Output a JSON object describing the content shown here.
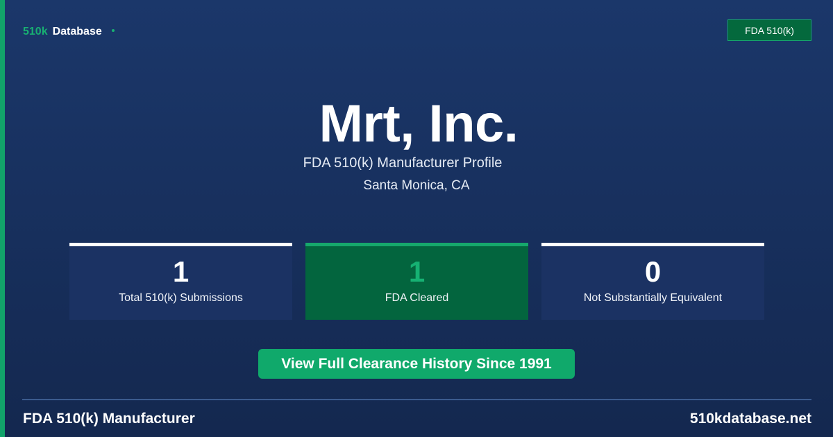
{
  "header": {
    "brand_accent": "510k",
    "brand_word": "Database",
    "badge": "FDA 510(k)"
  },
  "hero": {
    "title": "Mrt, Inc.",
    "subtitle": "FDA 510(k) Manufacturer Profile",
    "location": "Santa Monica, CA"
  },
  "stats": [
    {
      "value": "1",
      "label": "Total 510(k) Submissions"
    },
    {
      "value": "1",
      "label": "FDA Cleared"
    },
    {
      "value": "0",
      "label": "Not Substantially Equivalent"
    }
  ],
  "cta": {
    "label": "View Full Clearance History Since 1991"
  },
  "footer": {
    "left": "FDA 510(k) Manufacturer",
    "right": "510kdatabase.net"
  },
  "colors": {
    "background": "#1b376a",
    "accent_green": "#12a36a",
    "card": "#1b3263",
    "card_green": "#03653e"
  }
}
